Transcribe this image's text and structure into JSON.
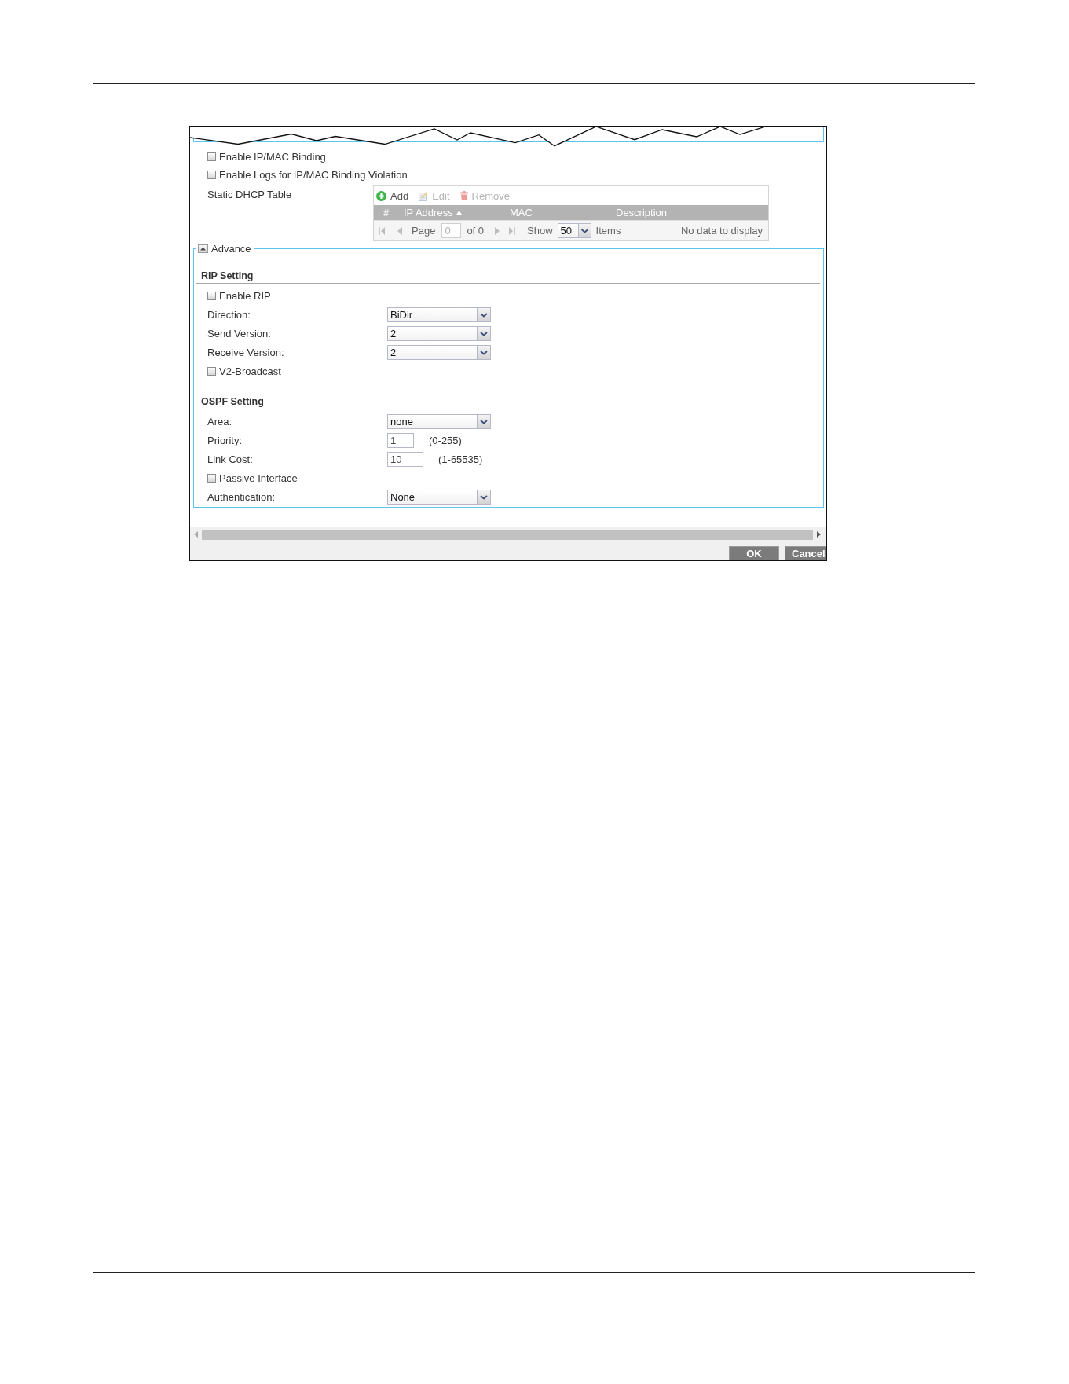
{
  "settings": [
    {
      "kind": "checkbox",
      "label": "Enable IP/MAC Binding",
      "checked": false
    },
    {
      "kind": "checkbox",
      "label": "Enable Logs for IP/MAC Binding Violation",
      "checked": false
    }
  ],
  "static_dhcp_table": {
    "label": "Static DHCP Table",
    "toolbar": [
      {
        "kind": "add",
        "label": "Add",
        "disabled": false
      },
      {
        "kind": "edit",
        "label": "Edit",
        "disabled": true
      },
      {
        "kind": "remove",
        "label": "Remove",
        "disabled": true
      }
    ],
    "columns": [
      {
        "label": "#",
        "sorted": false
      },
      {
        "label": "IP Address",
        "sorted": true
      },
      {
        "label": "MAC",
        "sorted": false
      },
      {
        "label": "Description",
        "sorted": false
      }
    ],
    "pager": {
      "page_label": "Page",
      "page": "0",
      "of": "of 0",
      "show_label": "Show",
      "show": "50",
      "items_label": "Items",
      "status": "No data to display"
    }
  },
  "advance": {
    "label": "Advance",
    "expanded": true,
    "sections": [
      {
        "title": "RIP Setting",
        "rows": [
          {
            "kind": "checkbox",
            "label": "Enable RIP",
            "checked": false
          },
          {
            "kind": "select",
            "label": "Direction:",
            "value": "BiDir"
          },
          {
            "kind": "select",
            "label": "Send Version:",
            "value": "2"
          },
          {
            "kind": "select",
            "label": "Receive Version:",
            "value": "2"
          },
          {
            "kind": "checkbox",
            "label": "V2-Broadcast",
            "checked": false
          }
        ]
      },
      {
        "title": "OSPF Setting",
        "rows": [
          {
            "kind": "select",
            "label": "Area:",
            "value": "none"
          },
          {
            "kind": "number",
            "label": "Priority:",
            "value": "1",
            "hint": "(0-255)"
          },
          {
            "kind": "number",
            "label": "Link Cost:",
            "value": "10",
            "hint": "(1-65535)"
          },
          {
            "kind": "checkbox",
            "label": "Passive Interface",
            "checked": false
          },
          {
            "kind": "select",
            "label": "Authentication:",
            "value": "None"
          }
        ]
      }
    ]
  },
  "buttons": [
    {
      "label": "OK"
    },
    {
      "label": "Cancel"
    }
  ]
}
